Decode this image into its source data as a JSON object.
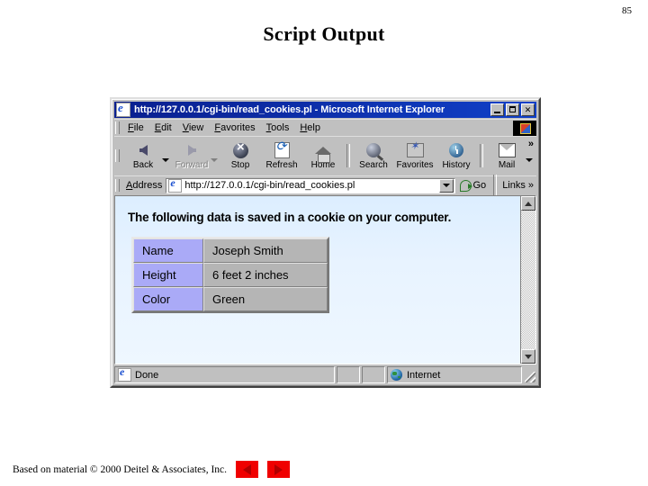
{
  "slide": {
    "page_number": "85",
    "title": "Script Output",
    "footer_text": "Based on material © 2000 Deitel & Associates, Inc.",
    "prev_button_label": "Previous slide",
    "next_button_label": "Next slide"
  },
  "browser": {
    "titlebar": {
      "text": "http://127.0.0.1/cgi-bin/read_cookies.pl - Microsoft Internet Explorer",
      "minimize_label": "Minimize",
      "maximize_label": "Maximize",
      "close_label": "✕"
    },
    "menu": [
      {
        "label": "File",
        "accel": "F",
        "rest": "ile"
      },
      {
        "label": "Edit",
        "accel": "E",
        "rest": "dit"
      },
      {
        "label": "View",
        "accel": "V",
        "rest": "iew"
      },
      {
        "label": "Favorites",
        "accel": "F",
        "rest": "avorites"
      },
      {
        "label": "Tools",
        "accel": "T",
        "rest": "ools"
      },
      {
        "label": "Help",
        "accel": "H",
        "rest": "elp"
      }
    ],
    "toolbar": {
      "buttons": [
        {
          "label": "Back",
          "icon": "back-arrow-icon",
          "enabled": true
        },
        {
          "label": "Forward",
          "icon": "forward-arrow-icon",
          "enabled": false
        },
        {
          "label": "Stop",
          "icon": "stop-icon",
          "enabled": true
        },
        {
          "label": "Refresh",
          "icon": "refresh-icon",
          "enabled": true
        },
        {
          "label": "Home",
          "icon": "home-icon",
          "enabled": true
        },
        {
          "label": "Search",
          "icon": "search-icon",
          "enabled": true
        },
        {
          "label": "Favorites",
          "icon": "favorites-icon",
          "enabled": true
        },
        {
          "label": "History",
          "icon": "history-icon",
          "enabled": true
        },
        {
          "label": "Mail",
          "icon": "mail-icon",
          "enabled": true
        }
      ],
      "overflow_chevron": "»"
    },
    "address_bar": {
      "label": "Address",
      "value": "http://127.0.0.1/cgi-bin/read_cookies.pl",
      "placeholder": "",
      "go_label": "Go",
      "links_label": "Links",
      "links_chevron": "»"
    },
    "page": {
      "heading": "The following data is saved in a cookie on your computer.",
      "table": {
        "rows": [
          {
            "key": "Name",
            "value": "Joseph Smith"
          },
          {
            "key": "Height",
            "value": "6 feet 2 inches"
          },
          {
            "key": "Color",
            "value": "Green"
          }
        ]
      }
    },
    "status_bar": {
      "message": "Done",
      "zone": "Internet"
    }
  },
  "colors": {
    "titlebar_blue": "#0a1f8f",
    "window_face": "#c0c0c0",
    "page_background": "#dceeff",
    "table_key_cell": "#aaaaf7",
    "table_value_cell": "#b5b5b5",
    "nav_button_red": "#f00000"
  }
}
